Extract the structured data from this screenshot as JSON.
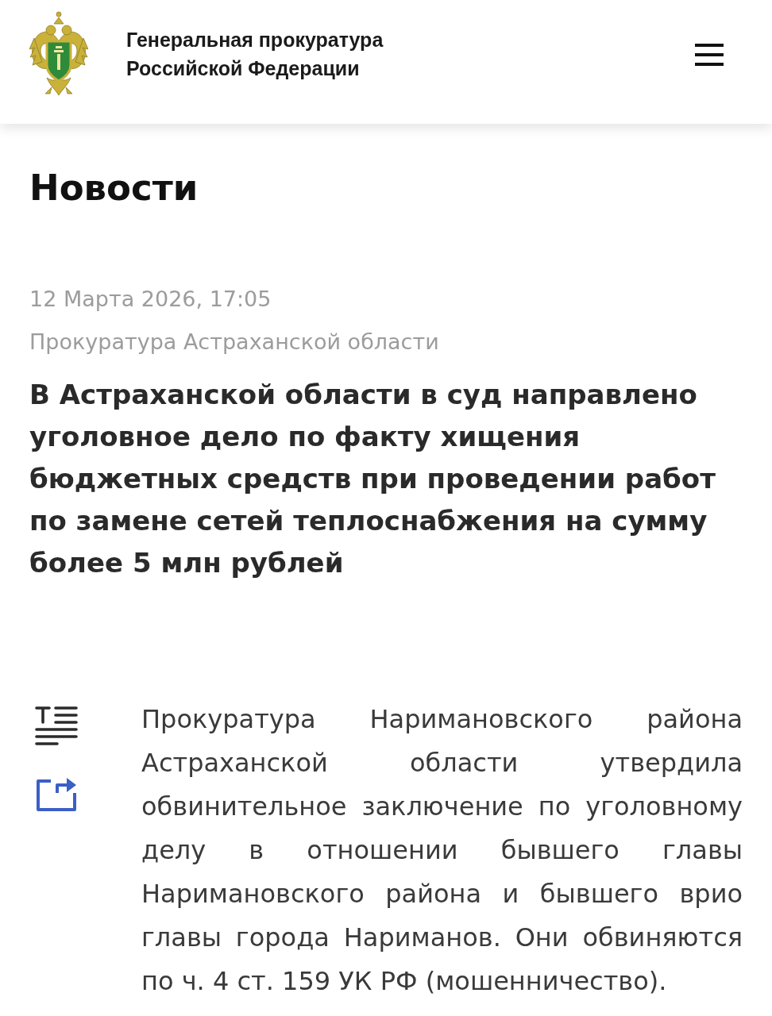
{
  "header": {
    "title": "Генеральная прокуратура Российской Федерации"
  },
  "section": {
    "title": "Новости"
  },
  "article": {
    "date": "12 Марта 2026, 17:05",
    "source": "Прокуратура Астраханской области",
    "headline": "В Астраханской области в суд направлено уголовное дело по факту хищения бюджетных средств при проведении работ по замене сетей теплоснабжения на сумму более 5 млн рублей",
    "body": "Прокуратура Наримановского района Астраханской области утвердила обвинительное заключение по уголовному делу в отношении бывшего главы Наримановского района и бывшего врио главы города Нариманов. Они обвиняются по ч. 4 ст. 159 УК РФ (мошенничество)."
  }
}
